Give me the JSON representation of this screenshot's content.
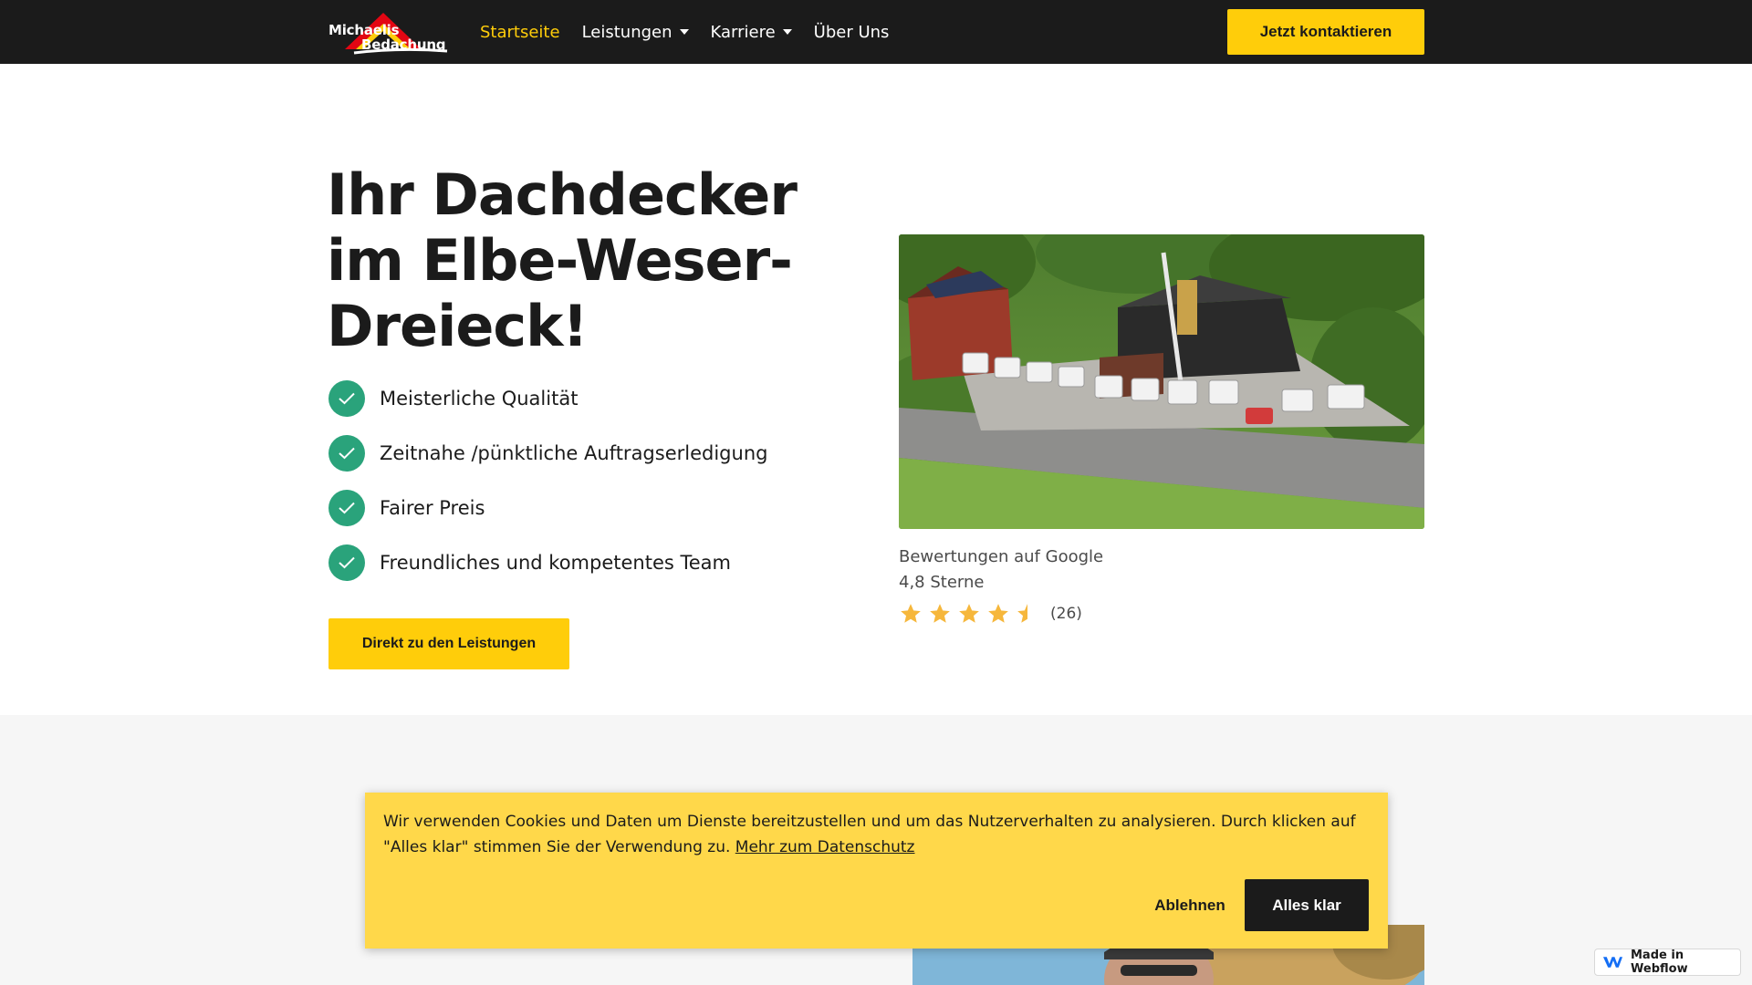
{
  "header": {
    "logo_line1": "Michaelis",
    "logo_line2": "Bedachung",
    "nav": [
      {
        "label": "Startseite",
        "active": true,
        "dropdown": false
      },
      {
        "label": "Leistungen",
        "active": false,
        "dropdown": true
      },
      {
        "label": "Karriere",
        "active": false,
        "dropdown": true
      },
      {
        "label": "Über Uns",
        "active": false,
        "dropdown": false
      }
    ],
    "cta_label": "Jetzt kontaktieren"
  },
  "hero": {
    "title": "Ihr Dachdecker im Elbe-Weser-Dreieck!",
    "features": [
      "Meisterliche Qualität",
      "Zeitnahe /pünktliche Auftragserledigung",
      "Fairer Preis",
      "Freundliches und kompetentes Team"
    ],
    "cta_label": "Direkt zu den Leistungen"
  },
  "reviews": {
    "title": "Bewertungen auf Google",
    "score": "4,8 Sterne",
    "rating": 4.8,
    "max_rating": 5,
    "count": "(26)"
  },
  "cookie": {
    "text": "Wir verwenden Cookies und Daten um Dienste bereitzustellen und um das Nutzerverhalten zu analysieren. Durch klicken auf \"Alles klar\" stimmen Sie der Verwendung zu.",
    "link": "Mehr zum Datenschutz",
    "decline": "Ablehnen",
    "accept": "Alles klar"
  },
  "badge": {
    "label": "Made in Webflow"
  },
  "colors": {
    "accent": "#ffcd0a",
    "dark": "#1b1b1b",
    "check": "#2aa37b",
    "star": "#f6b73c",
    "cookie_bg": "#ffd84a"
  }
}
